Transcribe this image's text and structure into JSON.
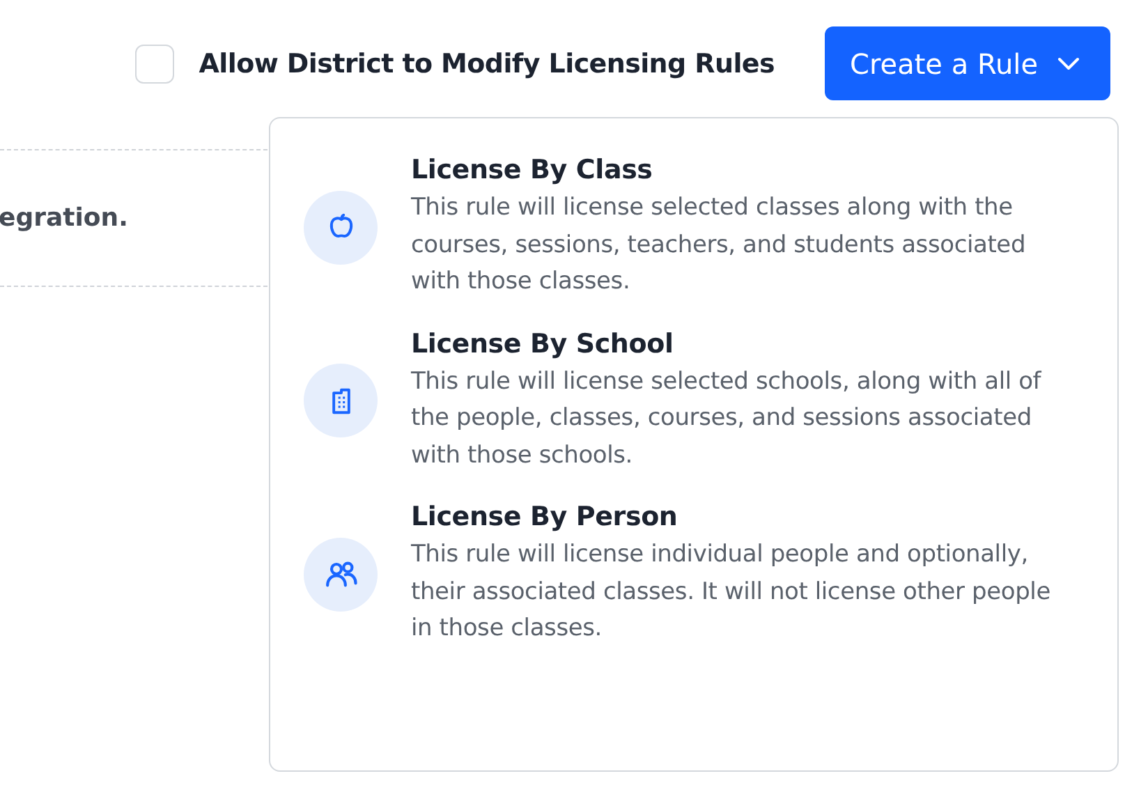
{
  "toolbar": {
    "allow_district": {
      "label": "Allow District to Modify Licensing Rules",
      "checked": false
    },
    "create_button": {
      "label": "Create a Rule",
      "expanded": true
    }
  },
  "background_text": "egration.",
  "menu": [
    {
      "kind": "apple",
      "title": "License By Class",
      "description": "This rule will license selected classes along with the courses, sessions, teachers, and students associated with those classes."
    },
    {
      "kind": "building",
      "title": "License By School",
      "description": "This rule will license selected schools, along with all of the people, classes, courses, and sessions associated with those schools."
    },
    {
      "kind": "people",
      "title": "License By Person",
      "description": "This rule will license individual people and optionally, their associated classes. It will not license other people in those classes."
    }
  ]
}
